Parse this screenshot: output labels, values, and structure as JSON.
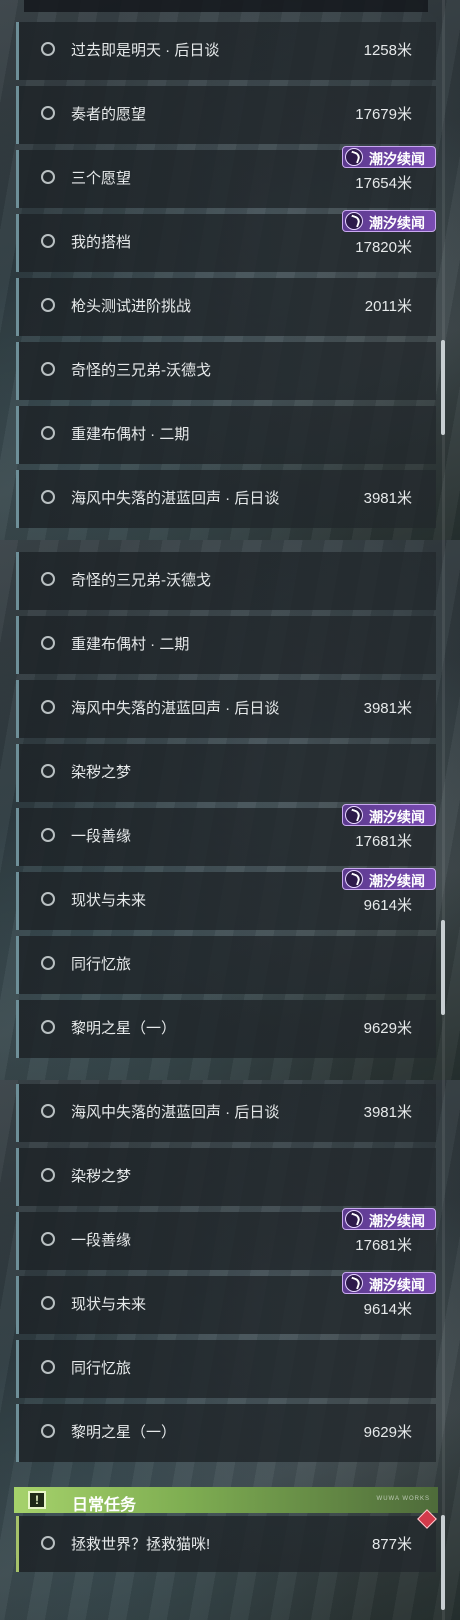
{
  "badge_label": "潮汐续闻",
  "daily": {
    "title": "日常任务",
    "tag": "WUWA WORKS",
    "quest": {
      "title": "拯救世界？拯救猫咪!",
      "distance": "877米"
    }
  },
  "panel1": [
    {
      "title": "过去即是明天 · 后日谈",
      "distance": "1258米"
    },
    {
      "title": "奏者的愿望",
      "distance": "17679米"
    },
    {
      "title": "三个愿望",
      "distance": "17654米",
      "badge": true
    },
    {
      "title": "我的搭档",
      "distance": "17820米",
      "badge": true
    },
    {
      "title": "枪头测试进阶挑战",
      "distance": "2011米"
    },
    {
      "title": "奇怪的三兄弟-沃德戈",
      "distance": ""
    },
    {
      "title": "重建布偶村 · 二期",
      "distance": ""
    },
    {
      "title": "海风中失落的湛蓝回声 · 后日谈",
      "distance": "3981米"
    }
  ],
  "panel2": [
    {
      "title": "奇怪的三兄弟-沃德戈",
      "distance": ""
    },
    {
      "title": "重建布偶村 · 二期",
      "distance": ""
    },
    {
      "title": "海风中失落的湛蓝回声 · 后日谈",
      "distance": "3981米"
    },
    {
      "title": "染秽之梦",
      "distance": ""
    },
    {
      "title": "一段善缘",
      "distance": "17681米",
      "badge": true
    },
    {
      "title": "现状与未来",
      "distance": "9614米",
      "badge": true
    },
    {
      "title": "同行忆旅",
      "distance": ""
    },
    {
      "title": "黎明之星（一）",
      "distance": "9629米"
    }
  ],
  "panel3": [
    {
      "title": "海风中失落的湛蓝回声 · 后日谈",
      "distance": "3981米"
    },
    {
      "title": "染秽之梦",
      "distance": ""
    },
    {
      "title": "一段善缘",
      "distance": "17681米",
      "badge": true
    },
    {
      "title": "现状与未来",
      "distance": "9614米",
      "badge": true
    },
    {
      "title": "同行忆旅",
      "distance": ""
    },
    {
      "title": "黎明之星（一）",
      "distance": "9629米"
    }
  ]
}
